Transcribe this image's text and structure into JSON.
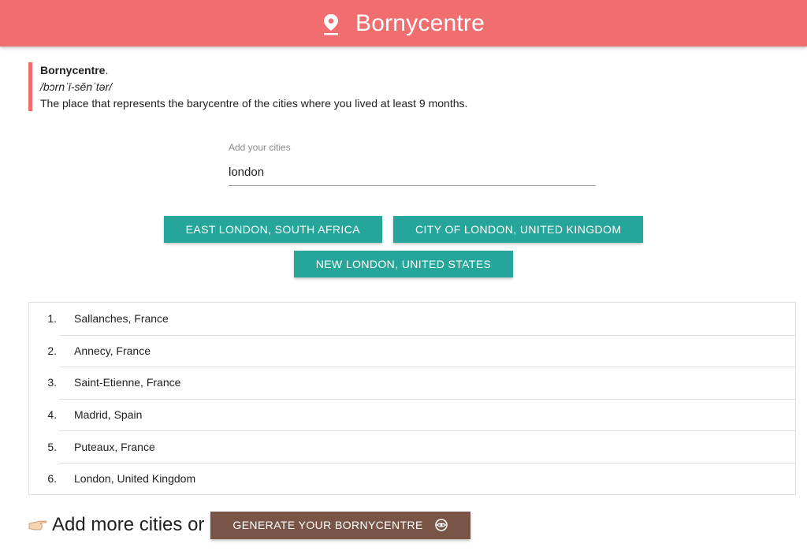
{
  "header": {
    "title": "Bornycentre",
    "icon": "location-pin-icon",
    "background_color": "#f06e70"
  },
  "definition": {
    "term": "Bornycentre",
    "punctuation": ".",
    "pronunciation": "/bɔrnˈī-sĕnˈtər/",
    "text": "The place that represents the barycentre of the cities where you lived at least 9 months."
  },
  "search": {
    "label": "Add your cities",
    "value": "london"
  },
  "suggestions": {
    "color": "#26a69a",
    "items": [
      "EAST LONDON, SOUTH AFRICA",
      "CITY OF LONDON, UNITED KINGDOM",
      "NEW LONDON, UNITED STATES"
    ]
  },
  "cities": [
    {
      "num": "1.",
      "name": "Sallanches, France"
    },
    {
      "num": "2.",
      "name": "Annecy, France"
    },
    {
      "num": "3.",
      "name": "Saint-Etienne, France"
    },
    {
      "num": "4.",
      "name": "Madrid, Spain"
    },
    {
      "num": "5.",
      "name": "Puteaux, France"
    },
    {
      "num": "6.",
      "name": "London, United Kingdom"
    }
  ],
  "footer": {
    "icon": "pointing-hand-icon",
    "text": "Add more cities or",
    "button_label": "GENERATE YOUR BORNYCENTRE",
    "button_icon": "eye-icon",
    "button_color": "#795548"
  }
}
